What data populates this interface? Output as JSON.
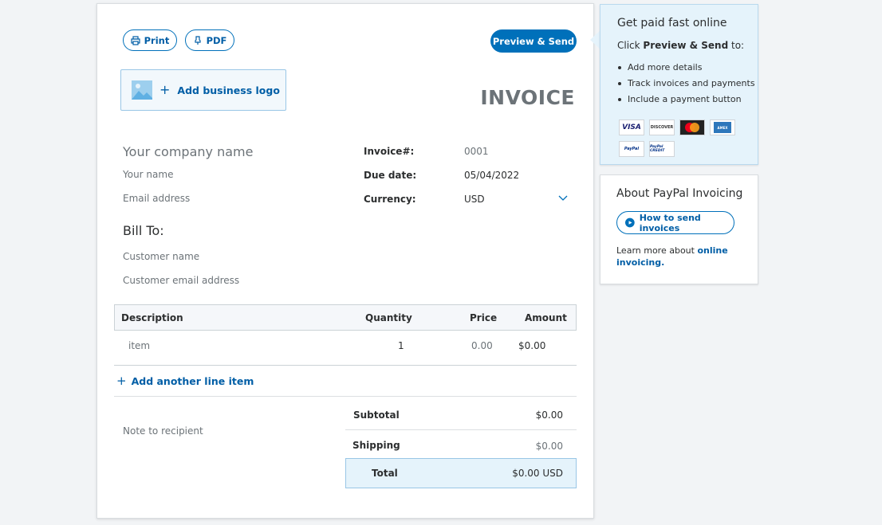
{
  "toolbar": {
    "print_label": "Print",
    "pdf_label": "PDF",
    "send_label": "Preview & Send"
  },
  "logo": {
    "label": "Add business logo"
  },
  "invoice": {
    "title": "INVOICE",
    "company_placeholder": "Your company name",
    "name_placeholder": "Your name",
    "email_placeholder": "Email address",
    "bill_to": "Bill To:",
    "customer_name_placeholder": "Customer name",
    "customer_email_placeholder": "Customer email address",
    "meta": {
      "number_label": "Invoice#:",
      "number_value": "0001",
      "due_label": "Due date:",
      "due_value": "05/04/2022",
      "currency_label": "Currency:",
      "currency_value": "USD"
    }
  },
  "table": {
    "headers": {
      "description": "Description",
      "quantity": "Quantity",
      "price": "Price",
      "amount": "Amount"
    },
    "rows": [
      {
        "description": "item",
        "quantity": "1",
        "price": "0.00",
        "amount": "$0.00"
      }
    ],
    "add_line": "Add another line item"
  },
  "note_placeholder": "Note to recipient",
  "totals": {
    "subtotal_label": "Subtotal",
    "subtotal_value": "$0.00",
    "shipping_label": "Shipping",
    "shipping_value": "$0.00",
    "total_label": "Total",
    "total_value": "$0.00 USD"
  },
  "promo": {
    "title": "Get paid fast online",
    "sub_prefix": "Click ",
    "sub_bold": "Preview & Send",
    "sub_suffix": " to:",
    "bullets": [
      "Add more details",
      "Track invoices and payments",
      "Include a payment button"
    ],
    "cards": [
      "VISA",
      "DISCOVER",
      "mastercard",
      "AMEX",
      "PayPal",
      "PayPal CREDIT"
    ]
  },
  "about": {
    "title": "About PayPal Invoicing",
    "how_label": "How to send invoices",
    "learn_prefix": "Learn more about ",
    "learn_link": "online invoicing."
  },
  "colors": {
    "accent": "#0070ba",
    "link": "#005ea6",
    "highlight_bg": "#e5f3fb"
  }
}
